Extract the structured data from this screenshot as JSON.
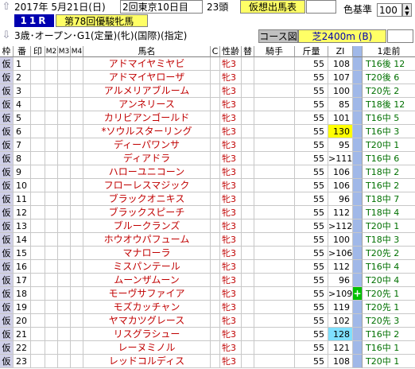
{
  "header": {
    "date": "2017年 5月21日(日)",
    "meeting": "2回東京10日目",
    "heads": "23頭",
    "mode_button": "仮想出馬表",
    "color_label": "色基準",
    "color_value": "100",
    "race_no": "11R",
    "race_name": "第78回優駿牝馬",
    "conditions": "3歳･オープン･G1(定量)(牝)(国際)(指定)",
    "course_button": "コース図",
    "course": "芝2400m (B)"
  },
  "columns": {
    "waku": "枠",
    "ban": "番",
    "mark": "印",
    "m2": "M2",
    "m3": "M3",
    "m4": "M4",
    "name": "馬名",
    "c": "C",
    "sex": "性齢",
    "burden": "替",
    "jockey": "騎手",
    "kinryo": "斤量",
    "zi": "ZI",
    "prev": "1走前"
  },
  "rows": [
    {
      "waku": "仮",
      "no": "1",
      "name": "アドマイヤミヤビ",
      "sex": "牝3",
      "kinryo": "55",
      "zi": "108",
      "prev": "T16後 12",
      "hl": ""
    },
    {
      "waku": "仮",
      "no": "2",
      "name": "アドマイヤローザ",
      "sex": "牝3",
      "kinryo": "55",
      "zi": "107",
      "prev": "T20後 6",
      "hl": ""
    },
    {
      "waku": "仮",
      "no": "3",
      "name": "アルメリアブルーム",
      "sex": "牝3",
      "kinryo": "55",
      "zi": "100",
      "prev": "T20先 2",
      "hl": ""
    },
    {
      "waku": "仮",
      "no": "4",
      "name": "アンネリース",
      "sex": "牝3",
      "kinryo": "55",
      "zi": "85",
      "prev": "T18後 12",
      "hl": ""
    },
    {
      "waku": "仮",
      "no": "5",
      "name": "カリビアンゴールド",
      "sex": "牝3",
      "kinryo": "55",
      "zi": "101",
      "prev": "T16中 5",
      "hl": ""
    },
    {
      "waku": "仮",
      "no": "6",
      "name": "*ソウルスターリング",
      "sex": "牝3",
      "kinryo": "55",
      "zi": "130",
      "prev": "T16中 3",
      "hl": "yellow"
    },
    {
      "waku": "仮",
      "no": "7",
      "name": "ディーパワンサ",
      "sex": "牝3",
      "kinryo": "55",
      "zi": "95",
      "prev": "T20中 1",
      "hl": ""
    },
    {
      "waku": "仮",
      "no": "8",
      "name": "ディアドラ",
      "sex": "牝3",
      "kinryo": "55",
      "zi": ">111",
      "prev": "T16中 6",
      "hl": ""
    },
    {
      "waku": "仮",
      "no": "9",
      "name": "ハローユニコーン",
      "sex": "牝3",
      "kinryo": "55",
      "zi": "106",
      "prev": "T18中 2",
      "hl": ""
    },
    {
      "waku": "仮",
      "no": "10",
      "name": "フローレスマジック",
      "sex": "牝3",
      "kinryo": "55",
      "zi": "106",
      "prev": "T16中 2",
      "hl": ""
    },
    {
      "waku": "仮",
      "no": "11",
      "name": "ブラックオニキス",
      "sex": "牝3",
      "kinryo": "55",
      "zi": "96",
      "prev": "T18中 7",
      "hl": ""
    },
    {
      "waku": "仮",
      "no": "12",
      "name": "ブラックスピーチ",
      "sex": "牝3",
      "kinryo": "55",
      "zi": "112",
      "prev": "T18中 4",
      "hl": ""
    },
    {
      "waku": "仮",
      "no": "13",
      "name": "ブルークランズ",
      "sex": "牝3",
      "kinryo": "55",
      "zi": ">112",
      "prev": "T20中 1",
      "hl": ""
    },
    {
      "waku": "仮",
      "no": "14",
      "name": "ホウオウパフューム",
      "sex": "牝3",
      "kinryo": "55",
      "zi": "100",
      "prev": "T18中 3",
      "hl": ""
    },
    {
      "waku": "仮",
      "no": "15",
      "name": "マナローラ",
      "sex": "牝3",
      "kinryo": "55",
      "zi": ">106",
      "prev": "T20先 2",
      "hl": ""
    },
    {
      "waku": "仮",
      "no": "16",
      "name": "ミスパンテール",
      "sex": "牝3",
      "kinryo": "55",
      "zi": "112",
      "prev": "T16中 4",
      "hl": ""
    },
    {
      "waku": "仮",
      "no": "17",
      "name": "ムーンザムーン",
      "sex": "牝3",
      "kinryo": "55",
      "zi": "96",
      "prev": "T20中 4",
      "hl": ""
    },
    {
      "waku": "仮",
      "no": "18",
      "name": "モーヴサファイア",
      "sex": "牝3",
      "kinryo": "55",
      "zi": ">109",
      "prev": "T20先 1",
      "hl": "",
      "plus": "+"
    },
    {
      "waku": "仮",
      "no": "19",
      "name": "モズカッチャン",
      "sex": "牝3",
      "kinryo": "55",
      "zi": "119",
      "prev": "T20先 1",
      "hl": ""
    },
    {
      "waku": "仮",
      "no": "20",
      "name": "ヤマカツグレース",
      "sex": "牝3",
      "kinryo": "55",
      "zi": "102",
      "prev": "T20先 3",
      "hl": ""
    },
    {
      "waku": "仮",
      "no": "21",
      "name": "リスグラシュー",
      "sex": "牝3",
      "kinryo": "55",
      "zi": "128",
      "prev": "T16中 2",
      "hl": "cyan"
    },
    {
      "waku": "仮",
      "no": "22",
      "name": "レーヌミノル",
      "sex": "牝3",
      "kinryo": "55",
      "zi": "121",
      "prev": "T16中 1",
      "hl": ""
    },
    {
      "waku": "仮",
      "no": "23",
      "name": "レッドコルディス",
      "sex": "牝3",
      "kinryo": "55",
      "zi": "108",
      "prev": "T20中 1",
      "hl": ""
    }
  ]
}
